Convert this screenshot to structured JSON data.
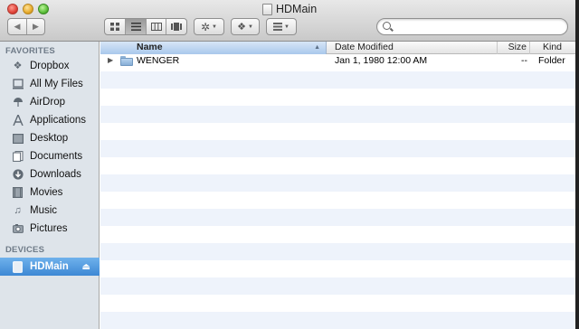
{
  "window": {
    "title": "HDMain"
  },
  "toolbar": {
    "back_icon": "back-arrow-icon",
    "forward_icon": "forward-arrow-icon",
    "view_modes": [
      "icon-view",
      "list-view",
      "column-view",
      "coverflow-view"
    ],
    "active_view": "list-view",
    "search_placeholder": ""
  },
  "sidebar": {
    "favorites_header": "FAVORITES",
    "favorites": [
      {
        "label": "Dropbox",
        "icon": "dropbox-icon"
      },
      {
        "label": "All My Files",
        "icon": "all-files-icon"
      },
      {
        "label": "AirDrop",
        "icon": "airdrop-icon"
      },
      {
        "label": "Applications",
        "icon": "applications-icon"
      },
      {
        "label": "Desktop",
        "icon": "desktop-icon"
      },
      {
        "label": "Documents",
        "icon": "documents-icon"
      },
      {
        "label": "Downloads",
        "icon": "downloads-icon"
      },
      {
        "label": "Movies",
        "icon": "movies-icon"
      },
      {
        "label": "Music",
        "icon": "music-icon"
      },
      {
        "label": "Pictures",
        "icon": "pictures-icon"
      }
    ],
    "devices_header": "DEVICES",
    "devices": [
      {
        "label": "HDMain",
        "icon": "hard-disk-icon",
        "selected": true
      }
    ]
  },
  "list": {
    "columns": {
      "name": "Name",
      "date": "Date Modified",
      "size": "Size",
      "kind": "Kind"
    },
    "rows": [
      {
        "name": "WENGER",
        "date": "Jan 1, 1980 12:00 AM",
        "size": "--",
        "kind": "Folder"
      }
    ]
  },
  "colors": {
    "selection": "#3d88d4",
    "sidebar_bg": "#dee4ea",
    "stripe": "#eef3fb"
  }
}
